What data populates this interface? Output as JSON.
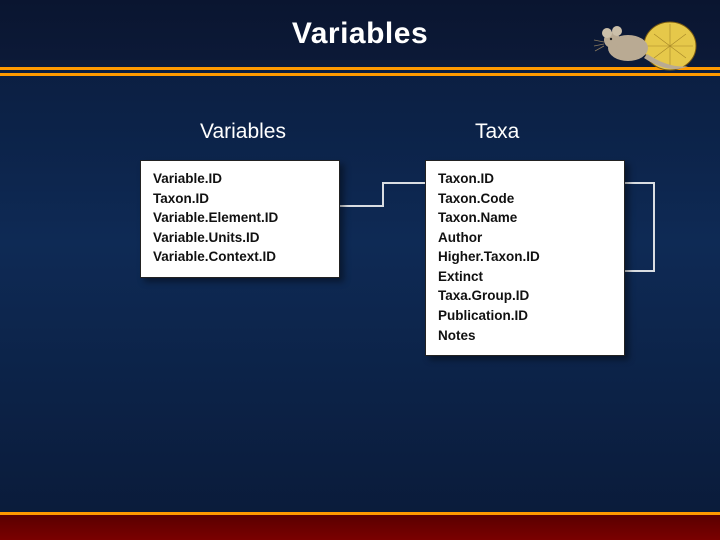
{
  "header": {
    "title": "Variables"
  },
  "columns": {
    "left": {
      "title": "Variables",
      "fields": [
        "Variable.ID",
        "Taxon.ID",
        "Variable.Element.ID",
        "Variable.Units.ID",
        "Variable.Context.ID"
      ]
    },
    "right": {
      "title": "Taxa",
      "fields": [
        "Taxon.ID",
        "Taxon.Code",
        "Taxon.Name",
        "Author",
        "Higher.Taxon.ID",
        "Extinct",
        "Taxa.Group.ID",
        "Publication.ID",
        "Notes"
      ]
    }
  },
  "logo": {
    "name": "packrat-midden-logo"
  }
}
